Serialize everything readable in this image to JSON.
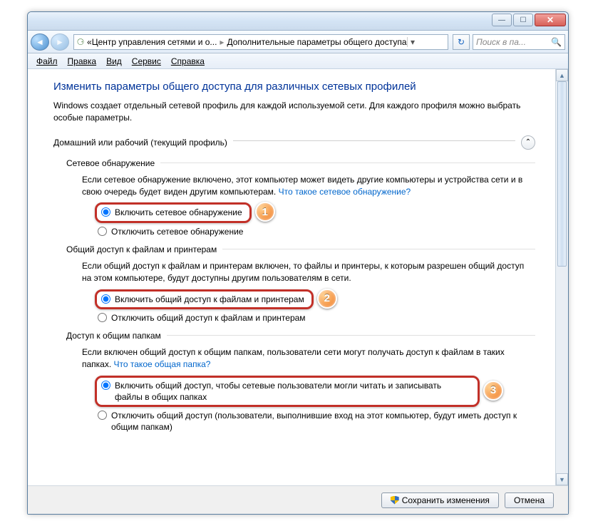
{
  "titlebar": {
    "min": "—",
    "max": "☐",
    "close": "✕"
  },
  "nav": {
    "back": "◄",
    "forward": "►",
    "crumb_prefix": "«",
    "crumb1": "Центр управления сетями и о...",
    "crumb2": "Дополнительные параметры общего доступа",
    "dropdown": "▾",
    "refresh": "↻",
    "search_placeholder": "Поиск в па...",
    "search_icon": "🔍"
  },
  "menu": {
    "file": "Файл",
    "edit": "Правка",
    "view": "Вид",
    "tools": "Сервис",
    "help": "Справка"
  },
  "page": {
    "title": "Изменить параметры общего доступа для различных сетевых профилей",
    "desc": "Windows создает отдельный сетевой профиль для каждой используемой сети. Для каждого профиля можно выбрать особые параметры.",
    "profile": "Домашний или рабочий (текущий профиль)",
    "chevron": "⌃"
  },
  "sections": {
    "discovery": {
      "title": "Сетевое обнаружение",
      "body": "Если сетевое обнаружение включено, этот компьютер может видеть другие компьютеры и устройства сети и в свою очередь будет виден другим компьютерам. ",
      "link": "Что такое сетевое обнаружение?",
      "opt_on": "Включить сетевое обнаружение",
      "opt_off": "Отключить сетевое обнаружение",
      "badge": "1"
    },
    "fileshare": {
      "title": "Общий доступ к файлам и принтерам",
      "body": "Если общий доступ к файлам и принтерам включен, то файлы и принтеры, к которым разрешен общий доступ на этом компьютере, будут доступны другим пользователям в сети.",
      "opt_on": "Включить общий доступ к файлам и принтерам",
      "opt_off": "Отключить общий доступ к файлам и принтерам",
      "badge": "2"
    },
    "public": {
      "title": "Доступ к общим папкам",
      "body": "Если включен общий доступ к общим папкам, пользователи сети могут получать доступ к файлам в таких папках. ",
      "link": "Что такое общая папка?",
      "opt_on": "Включить общий доступ, чтобы сетевые пользователи могли читать и записывать файлы в общих папках",
      "opt_off": "Отключить общий доступ (пользователи, выполнившие вход на этот компьютер, будут иметь доступ к общим папкам)",
      "badge": "3"
    }
  },
  "footer": {
    "save": "Сохранить изменения",
    "cancel": "Отмена"
  }
}
